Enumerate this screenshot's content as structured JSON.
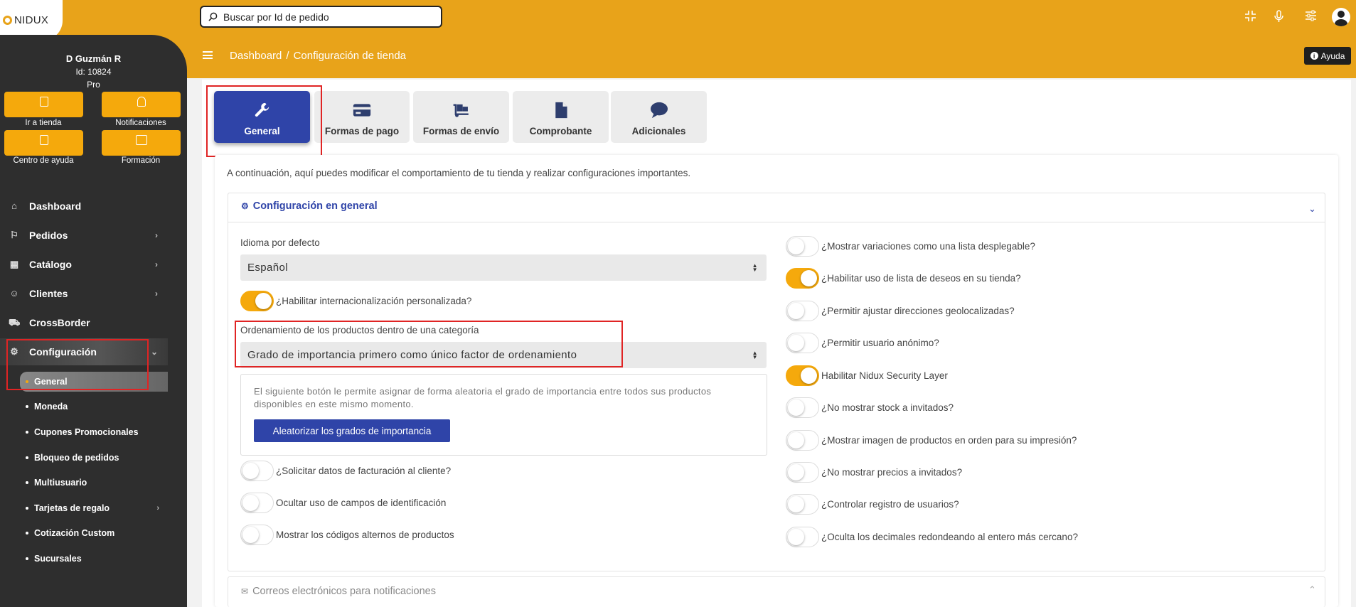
{
  "brand": {
    "logo_text": "NIDUX"
  },
  "search": {
    "placeholder": "Buscar por Id de pedido"
  },
  "header": {
    "icons": [
      "compress-icon",
      "microphone-icon",
      "sliders-icon",
      "user-avatar-icon"
    ],
    "breadcrumb": [
      "Dashboard",
      "/",
      "Configuración de tienda"
    ],
    "help_label": "Ayuda"
  },
  "user": {
    "name": "D Guzmán R",
    "id": "Id: 10824",
    "plan": "Pro"
  },
  "quick_actions": [
    {
      "label": "Ir a tienda",
      "icon": "store-icon"
    },
    {
      "label": "Notificaciones",
      "icon": "bell-icon"
    },
    {
      "label": "Centro de ayuda",
      "icon": "book-icon"
    },
    {
      "label": "Formación",
      "icon": "training-icon"
    }
  ],
  "nav": [
    {
      "label": "Dashboard",
      "icon": "home-icon",
      "has_children": false
    },
    {
      "label": "Pedidos",
      "icon": "flag-icon",
      "has_children": true
    },
    {
      "label": "Catálogo",
      "icon": "catalog-icon",
      "has_children": true
    },
    {
      "label": "Clientes",
      "icon": "users-icon",
      "has_children": true
    },
    {
      "label": "CrossBorder",
      "icon": "shipping-icon",
      "has_children": false
    },
    {
      "label": "Configuración",
      "icon": "config-icon",
      "has_children": true,
      "expanded": true
    }
  ],
  "subnav": [
    {
      "label": "General",
      "active": true
    },
    {
      "label": "Moneda"
    },
    {
      "label": "Cupones Promocionales"
    },
    {
      "label": "Bloqueo de pedidos"
    },
    {
      "label": "Multiusuario"
    },
    {
      "label": "Tarjetas de regalo",
      "has_children": true
    },
    {
      "label": "Cotización Custom"
    },
    {
      "label": "Sucursales"
    }
  ],
  "tabs": [
    {
      "label": "General",
      "icon": "wrench-icon",
      "active": true
    },
    {
      "label": "Formas de pago",
      "icon": "credit-card-icon"
    },
    {
      "label": "Formas de envío",
      "icon": "dolly-icon"
    },
    {
      "label": "Comprobante",
      "icon": "document-icon"
    },
    {
      "label": "Adicionales",
      "icon": "comment-icon"
    }
  ],
  "intro": "A continuación, aquí puedes modificar el comportamiento de tu tienda y realizar configuraciones importantes.",
  "section_general": {
    "title": "Configuración en general",
    "language_label": "Idioma por defecto",
    "language_value": "Español",
    "i18n_toggle": {
      "label": "¿Habilitar internacionalización personalizada?",
      "on": true
    },
    "ordering_label": "Ordenamiento de los productos dentro de una categoría",
    "ordering_value": "Grado de importancia primero como único factor de ordenamiento",
    "random_text": "El siguiente botón le permite asignar de forma aleatoria el grado de importancia entre todos sus productos disponibles en este mismo momento.",
    "random_button": "Aleatorizar los grados de importancia",
    "left_toggles": [
      {
        "label": "¿Solicitar datos de facturación al cliente?",
        "on": false
      },
      {
        "label": "Ocultar uso de campos de identificación",
        "on": false
      },
      {
        "label": "Mostrar los códigos alternos de productos",
        "on": false
      }
    ],
    "right_toggles": [
      {
        "label": "¿Mostrar variaciones como una lista desplegable?",
        "on": false
      },
      {
        "label": "¿Habilitar uso de lista de deseos en su tienda?",
        "on": true
      },
      {
        "label": "¿Permitir ajustar direcciones geolocalizadas?",
        "on": false
      },
      {
        "label": "¿Permitir usuario anónimo?",
        "on": false
      },
      {
        "label": "Habilitar Nidux Security Layer",
        "on": true
      },
      {
        "label": "¿No mostrar stock a invitados?",
        "on": false
      },
      {
        "label": "¿Mostrar imagen de productos en orden para su impresión?",
        "on": false
      },
      {
        "label": "¿No mostrar precios a invitados?",
        "on": false
      },
      {
        "label": "¿Controlar registro de usuarios?",
        "on": false
      },
      {
        "label": "¿Oculta los decimales redondeando al entero más cercano?",
        "on": false
      }
    ]
  },
  "section_emails": {
    "title": "Correos electrónicos para notificaciones"
  },
  "colors": {
    "header": "#e8a31a",
    "sidebar": "#2e2e2e",
    "accent": "#2f44a8",
    "toggle_on": "#f5a90c",
    "highlight": "#e02424"
  }
}
